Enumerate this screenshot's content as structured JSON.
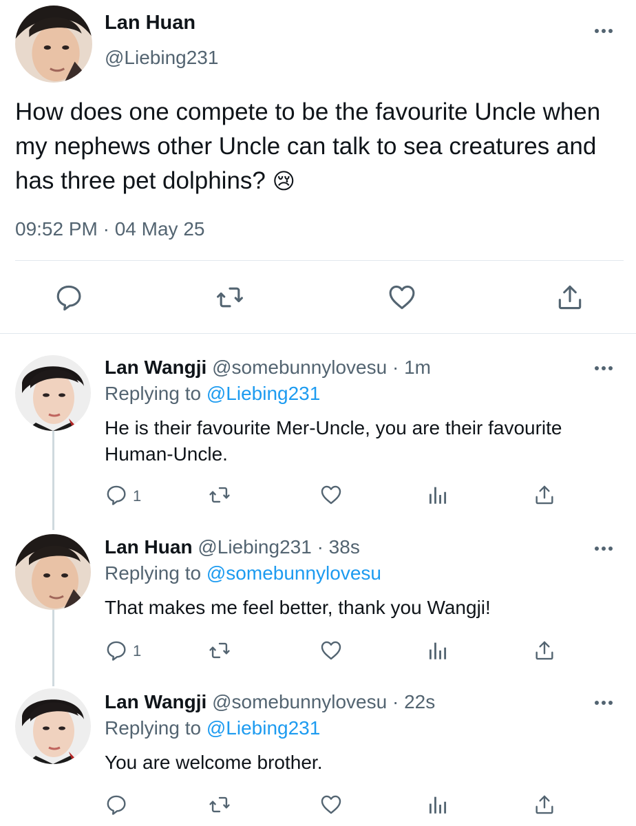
{
  "main_tweet": {
    "name": "Lan Huan",
    "handle": "@Liebing231",
    "text": "How does one compete to be the favourite Uncle when my nephews other Uncle can talk to sea creatures and has three pet dolphins?",
    "emoji": "😢",
    "timestamp": "09:52 PM · 04 May 25",
    "avatar_icon": "avatar-lan-huan"
  },
  "replies": [
    {
      "name": "Lan Wangji",
      "meta": "@somebunnylovesu · 1m",
      "replying_prefix": "Replying to ",
      "replying_to": "@Liebing231",
      "text": "He is their favourite Mer-Uncle, you are their favourite Human-Uncle.",
      "reply_count": "1"
    },
    {
      "name": "Lan Huan",
      "meta": "@Liebing231 · 38s",
      "replying_prefix": "Replying to ",
      "replying_to": "@somebunnylovesu",
      "text": "That makes me feel better, thank you Wangji!",
      "reply_count": "1"
    },
    {
      "name": "Lan Wangji",
      "meta": "@somebunnylovesu · 22s",
      "replying_prefix": "Replying to ",
      "replying_to": "@Liebing231",
      "text": "You are welcome brother.",
      "reply_count": ""
    }
  ],
  "colors": {
    "text": "#0f1419",
    "secondary": "#536471",
    "link": "#1d9bf0",
    "divider": "#e1e8ed",
    "thread_line": "#cfd9de"
  },
  "icons": [
    "comment-icon",
    "retweet-icon",
    "like-icon",
    "share-icon",
    "analytics-icon",
    "more-icon"
  ]
}
